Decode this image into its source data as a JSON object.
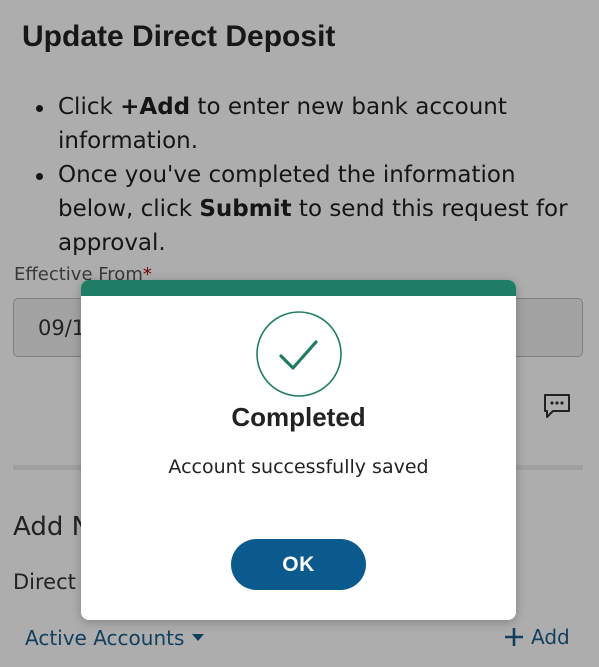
{
  "page": {
    "title": "Update Direct Deposit",
    "instructions": [
      {
        "prefix": "Click ",
        "bold": "+Add",
        "suffix": " to enter new bank account information."
      },
      {
        "prefix": "Once you've completed the information below, click ",
        "bold": "Submit",
        "suffix": " to send this request for approval."
      }
    ],
    "effective_from_label": "Effective From",
    "required_marker": "*",
    "effective_from_value": "09/1",
    "section_heading": "Add N",
    "direct_label": "Direct",
    "active_accounts_label": "Active Accounts",
    "add_label": "Add"
  },
  "modal": {
    "title": "Completed",
    "message": "Account successfully saved",
    "ok_label": "OK"
  },
  "colors": {
    "accent_green": "#1e7d64",
    "button_blue": "#0b5a8e",
    "link_blue": "#1b5e8a",
    "required_red": "#aa0000"
  },
  "icons": [
    "comment-icon",
    "caret-down-icon",
    "plus-icon",
    "checkmark-icon"
  ]
}
